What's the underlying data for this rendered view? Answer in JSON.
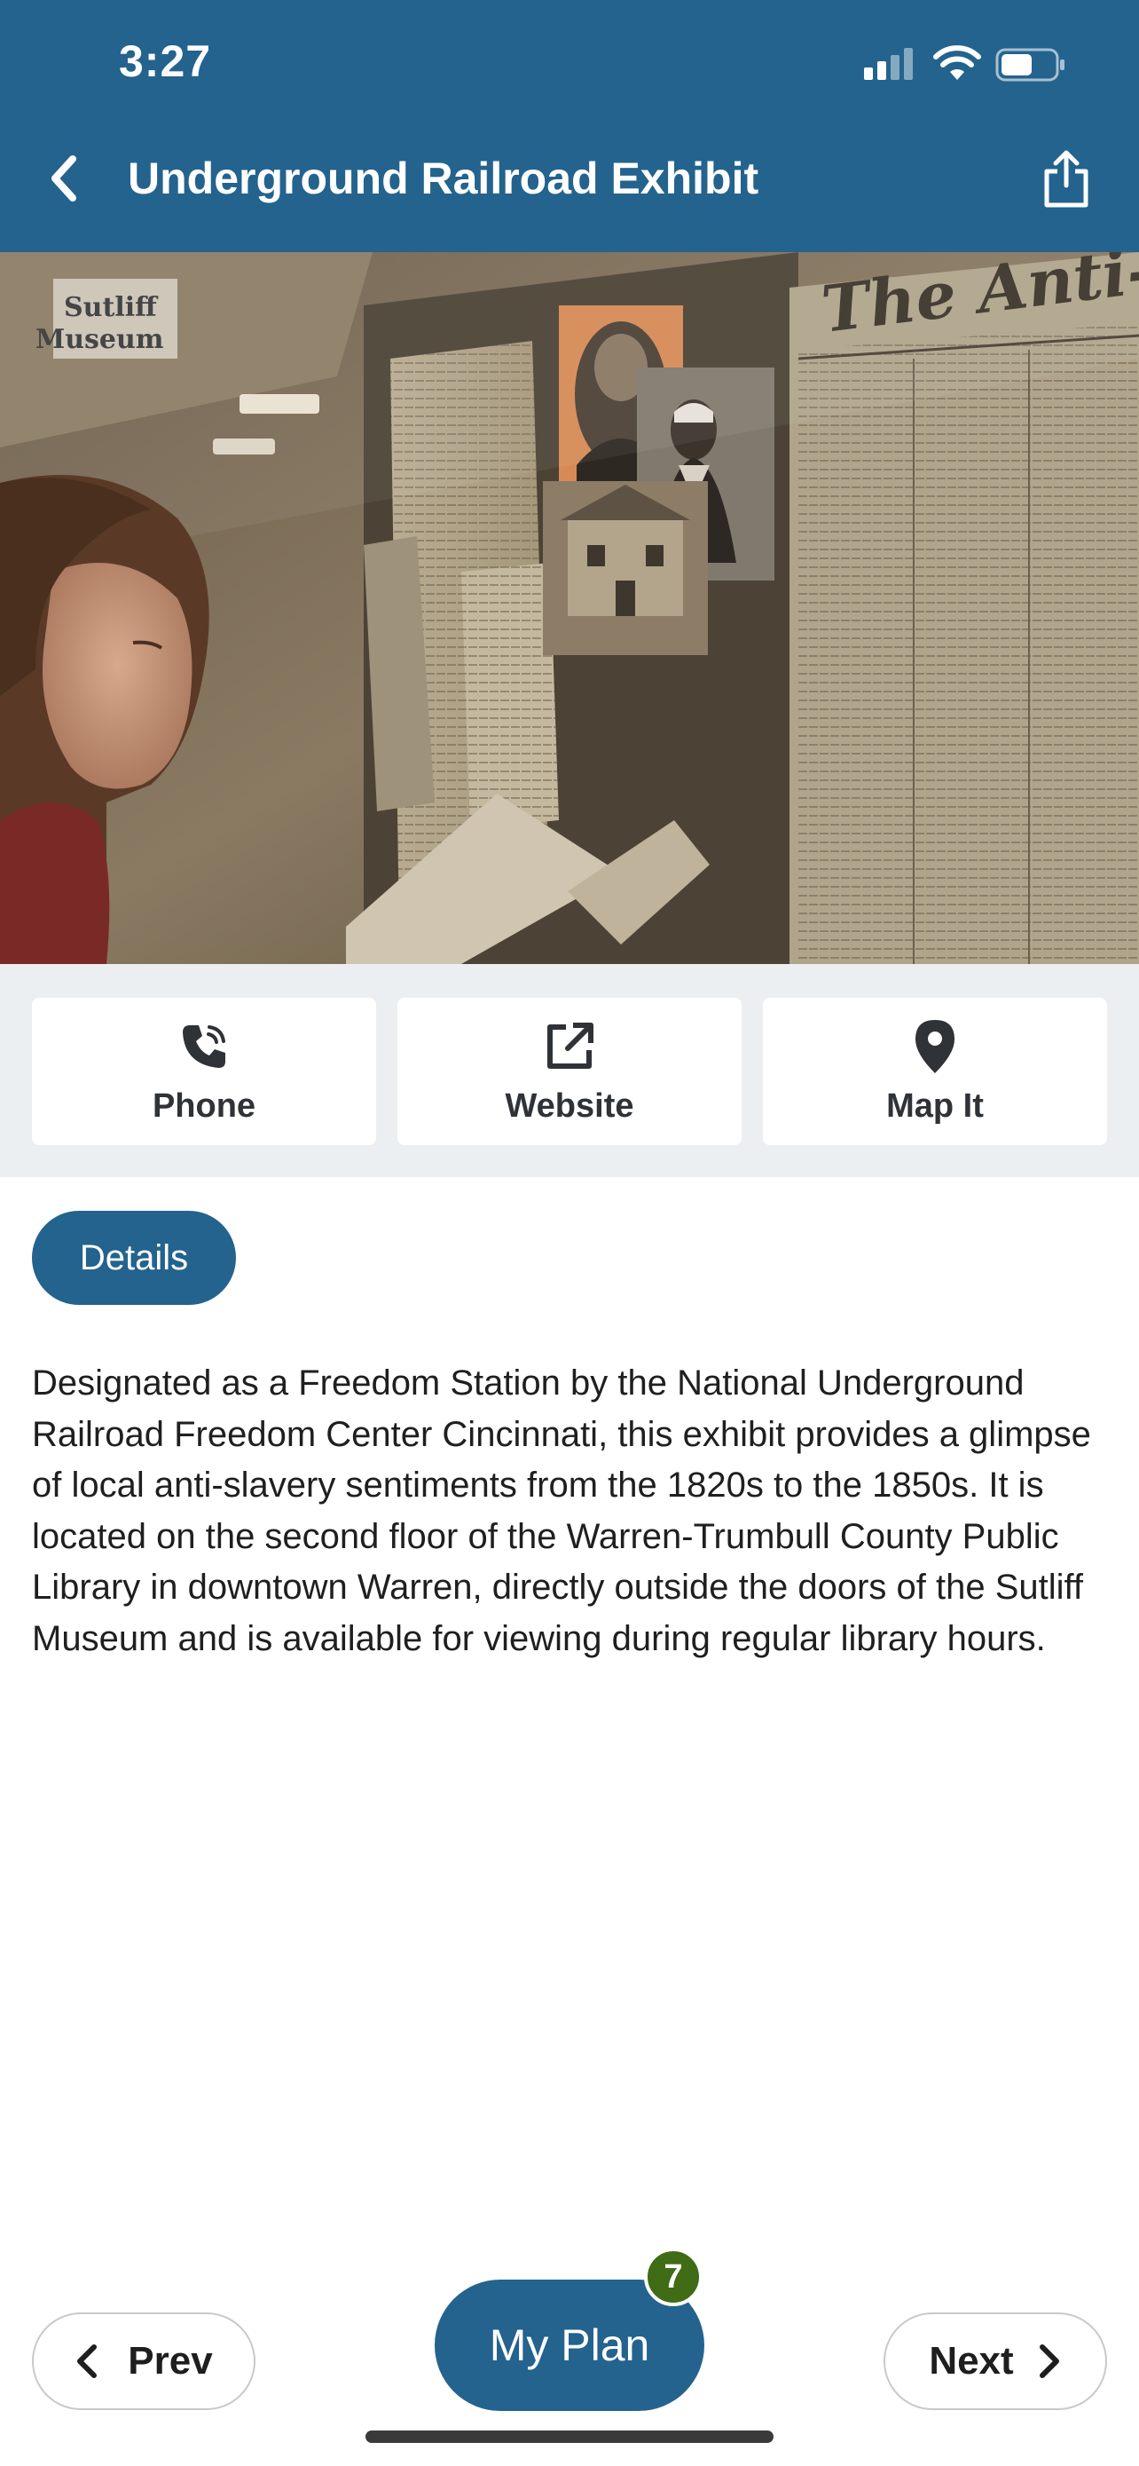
{
  "status_bar": {
    "time": "3:27",
    "icons": [
      "cellular-signal-icon",
      "wifi-icon",
      "battery-icon"
    ]
  },
  "header": {
    "title": "Underground Railroad Exhibit",
    "back_icon": "chevron-left-icon",
    "share_icon": "share-icon",
    "color": "#23638e"
  },
  "hero_image": {
    "sign_text": [
      "Sutliff",
      "Museum"
    ],
    "newspaper_masthead": "The Anti-Sl"
  },
  "actions": [
    {
      "label": "Phone",
      "icon": "phone-icon"
    },
    {
      "label": "Website",
      "icon": "external-link-icon"
    },
    {
      "label": "Map It",
      "icon": "map-pin-icon"
    }
  ],
  "tabs": {
    "active": "Details"
  },
  "description": "Designated as a Freedom Station by the National Underground Railroad Freedom Center Cincinnati, this exhibit provides a glimpse of local anti-slavery sentiments from the 1820s to the 1850s. It is located on the second floor of the Warren-Trumbull County Public Library in downtown Warren, directly outside the doors of the Sutliff Museum and is available for viewing during regular library hours.",
  "footer": {
    "prev_label": "Prev",
    "next_label": "Next",
    "my_plan_label": "My Plan",
    "my_plan_count": "7",
    "badge_color": "#3f6c14"
  }
}
